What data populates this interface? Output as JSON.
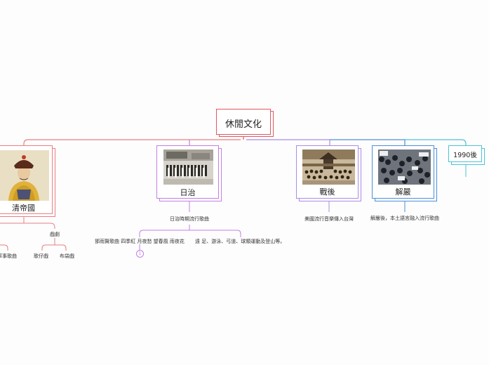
{
  "colors": {
    "root": "#e0585f",
    "qing": "#e87f84",
    "japan": "#c27ee6",
    "postwar": "#a98ce8",
    "martial": "#4b8fd9",
    "after1990": "#4ec2d6"
  },
  "root": {
    "label": "休閒文化"
  },
  "branches": {
    "qing": {
      "label": "清帝國",
      "image_icon": "qing-emperor-portrait",
      "sub_opera": "戲劇",
      "sub_military": "軍事歌曲",
      "sub_gezai": "歌仔戲",
      "sub_budai": "布袋戲"
    },
    "japan": {
      "label": "日治",
      "image_icon": "colonial-parade-photo",
      "child": "日治時期流行歌曲",
      "songs": "鄧雨賢歌曲 四季紅 月夜愁 望春風 雨夜花",
      "sports": "遠 足、游泳、弓道、球類運動及登山等。",
      "badge": "1"
    },
    "postwar": {
      "label": "戰後",
      "image_icon": "military-gathering-photo",
      "child": "美國流行音樂傳入台灣"
    },
    "martial": {
      "label": "解嚴",
      "image_icon": "crowd-protest-photo",
      "child": "解嚴後，本土語言融入流行歌曲"
    },
    "after1990": {
      "label": "1990後"
    }
  }
}
